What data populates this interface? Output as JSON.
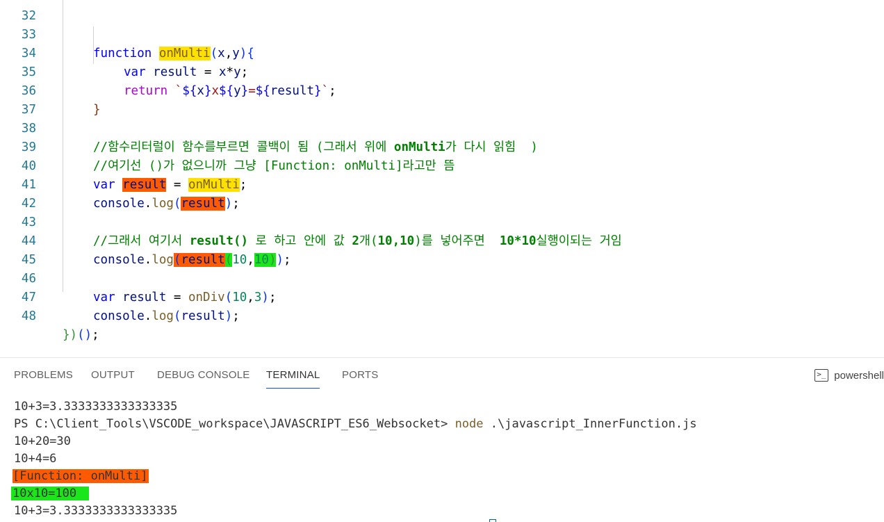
{
  "editor": {
    "line_numbers": [
      "32",
      "33",
      "34",
      "35",
      "36",
      "37",
      "38",
      "39",
      "40",
      "41",
      "42",
      "43",
      "44",
      "45",
      "46",
      "47",
      "48"
    ],
    "code": {
      "l33": {
        "kw": "function ",
        "fn": "onMulti",
        "open": "(",
        "x": "x",
        ",": ",",
        "y": "y",
        "close": ")",
        "brace": "{"
      },
      "l34": {
        "kw": "var ",
        "v": "result",
        " eq": " = ",
        "x": "x",
        "op": "*",
        "y": "y",
        "semi": ";"
      },
      "l35": {
        "kw": "return ",
        "tick": "`",
        "d1": "${",
        "x": "x",
        "c1": "}",
        "lit": "x",
        "d2": "${",
        "y": "y",
        "c2": "}",
        "eqs": "=",
        "d3": "${",
        "r": "result",
        "c3": "}",
        "tick2": "`",
        "semi": ";"
      },
      "l36": {
        "brace": "}"
      },
      "l38": {
        "comment_a": "//함수리터럴이 함수를부르면 콜백이 됨 (그래서 위에 ",
        "comment_b": "onMulti",
        "comment_c": "가 다시 읽힘  )"
      },
      "l39": {
        "comment_a": "//여기선 ()가 없으니까 그냥 ",
        "comment_b": "[Function: onMulti]",
        "comment_c": "라고만 뜸"
      },
      "l40": {
        "kw": "var ",
        "v": "result",
        "eq": " = ",
        "fn": "onMulti",
        "semi": ";"
      },
      "l41": {
        "obj": "console",
        "dot": ".",
        "fn": "log",
        "open": "(",
        "v": "result",
        "close": ")",
        "semi": ";"
      },
      "l43": {
        "comment_a": "//그래서 여기서 ",
        "comment_b": "result()",
        "comment_c": " 로 하고 안에 값 ",
        "comment_d": "2",
        "comment_e": "개(",
        "comment_f": "10,10",
        "comment_g": ")를 넣어주면  ",
        "comment_h": "10*10",
        "comment_i": "실행이되는 거임"
      },
      "l44": {
        "obj": "console",
        "dot": ".",
        "fn": "log",
        "open": "(",
        "v": "result",
        "open2": "(",
        "n1": "10",
        ",": ",",
        "n2": "10",
        "close2": ")",
        "close": ")",
        "semi": ";"
      },
      "l46": {
        "kw": "var ",
        "v": "result",
        "eq": " = ",
        "fn": "onDiv",
        "open": "(",
        "n1": "10",
        ",": ",",
        "n2": "3",
        "close": ")",
        "semi": ";"
      },
      "l47": {
        "obj": "console",
        "dot": ".",
        "fn": "log",
        "open": "(",
        "v": "result",
        "close": ")",
        "semi": ";"
      },
      "l48": {
        "b1": "}",
        "p1": ")",
        "p2": "()",
        "semi": ";"
      }
    }
  },
  "panel": {
    "tabs": [
      "PROBLEMS",
      "OUTPUT",
      "DEBUG CONSOLE",
      "TERMINAL",
      "PORTS"
    ],
    "active_tab": "TERMINAL",
    "shell_label": "powershell",
    "shell_icon": "terminal-icon"
  },
  "terminal": {
    "lines": [
      "10+3=3.3333333333333335",
      "PS C:\\Client_Tools\\VSCODE_workspace\\JAVASCRIPT_ES6_Websocket> ",
      "10+20=30",
      "10+4=6",
      "[Function: onMulti]",
      "10x10=100 ",
      "10+3=3.3333333333333335"
    ],
    "command": "node",
    "command_arg": " .\\javascript_InnerFunction.js"
  },
  "colors": {
    "highlight_yellow": "#ffe100",
    "highlight_orange": "#ff5a00",
    "highlight_green": "#1ae61a",
    "accent": "#005fb8"
  }
}
